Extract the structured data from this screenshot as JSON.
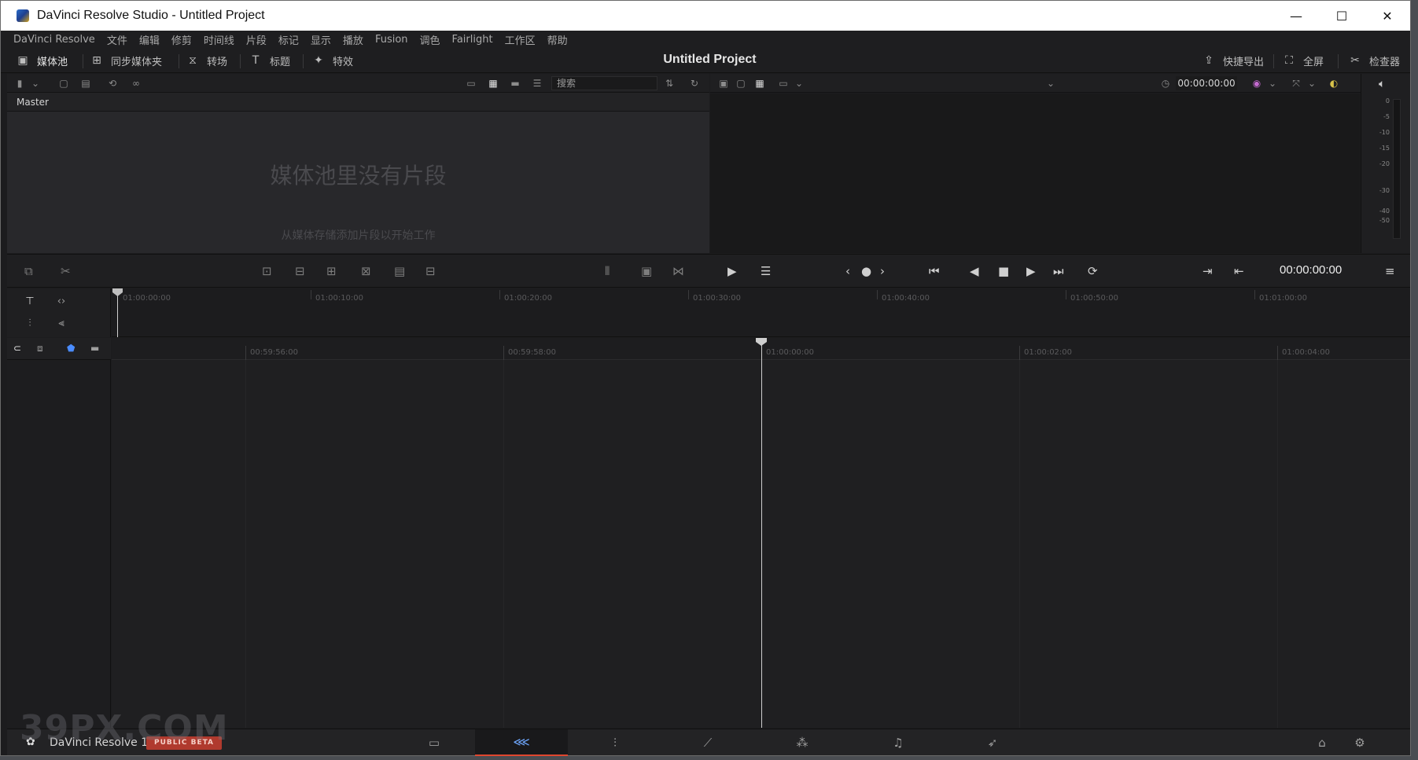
{
  "window": {
    "title": "DaVinci Resolve Studio - Untitled Project",
    "controls": {
      "minimize": "—",
      "maximize": "☐",
      "close": "✕"
    }
  },
  "menubar": {
    "items": [
      "DaVinci Resolve",
      "文件",
      "编辑",
      "修剪",
      "时间线",
      "片段",
      "标记",
      "显示",
      "播放",
      "Fusion",
      "调色",
      "Fairlight",
      "工作区",
      "帮助"
    ]
  },
  "toolbar": {
    "media_pool": "媒体池",
    "sync_bin": "同步媒体夹",
    "transitions": "转场",
    "titles": "标题",
    "effects": "特效",
    "project_title": "Untitled Project",
    "quick_export": "快捷导出",
    "fullscreen": "全屏",
    "inspector": "检查器"
  },
  "media_pool": {
    "search_placeholder": "搜索",
    "bin": "Master",
    "empty_title": "媒体池里没有片段",
    "empty_subtitle": "从媒体存储添加片段以开始工作"
  },
  "viewer": {
    "timecode": "00:00:00:00",
    "main_timecode": "00:00:00:00"
  },
  "audio_meter": {
    "scale": [
      "0",
      "-5",
      "-10",
      "-15",
      "-20",
      "-30",
      "-40",
      "-50"
    ]
  },
  "timeline": {
    "upper_ruler": [
      "01:00:00:00",
      "01:00:10:00",
      "01:00:20:00",
      "01:00:30:00",
      "01:00:40:00",
      "01:00:50:00",
      "01:01:00:00"
    ],
    "lower_ruler": [
      "00:59:56:00",
      "00:59:58:00",
      "01:00:00:00",
      "01:00:02:00",
      "01:00:04:00"
    ]
  },
  "pagebar": {
    "brand": "DaVinci Resolve 18",
    "badge": "PUBLIC BETA",
    "watermark": "39PX.COM"
  },
  "colors": {
    "accent": "#e0462e",
    "active_tab_icon": "#6fa8ff",
    "beta_badge": "#b03a2e"
  }
}
